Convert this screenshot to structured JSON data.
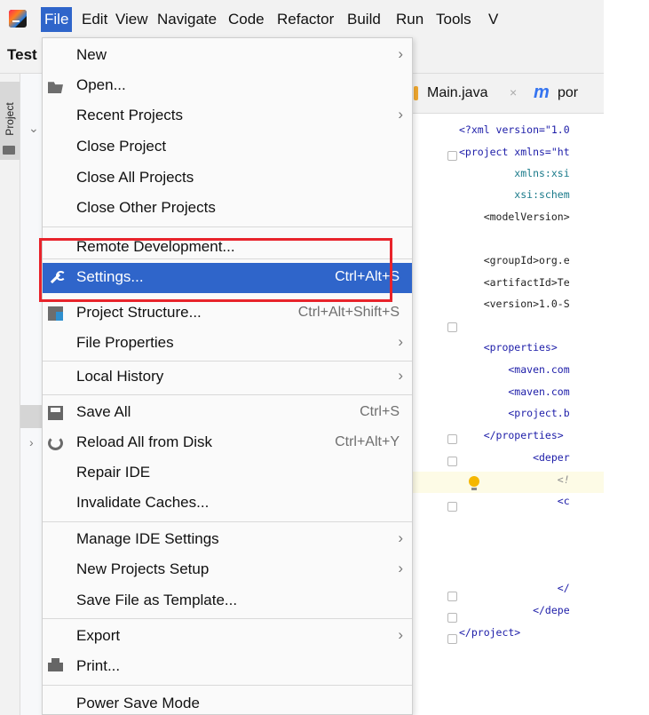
{
  "menubar": {
    "items": [
      {
        "label": "File",
        "active": true
      },
      {
        "label": "Edit"
      },
      {
        "label": "View"
      },
      {
        "label": "Navigate"
      },
      {
        "label": "Code"
      },
      {
        "label": "Refactor"
      },
      {
        "label": "Build"
      },
      {
        "label": "Run"
      },
      {
        "label": "Tools"
      },
      {
        "label": "V"
      }
    ]
  },
  "project": {
    "name": "Test",
    "tool_window_label": "Project"
  },
  "editor": {
    "tabs": [
      {
        "label": "Main.java"
      },
      {
        "label": "por"
      }
    ],
    "lines": [
      "<?xml version=\"1.0",
      "<project xmlns=\"ht",
      "         xmlns:xsi",
      "         xsi:schem",
      "    <modelVersion>",
      "",
      "    <groupId>org.e",
      "    <artifactId>Te",
      "    <version>1.0-S",
      "",
      "    <properties>",
      "        <maven.com",
      "        <maven.com",
      "        <project.b",
      "    </properties>",
      "            <deper",
      "                <!",
      "                <c",
      "",
      "",
      "",
      "                </",
      "            </depe",
      "</project>"
    ]
  },
  "file_menu": {
    "items": [
      {
        "label": "New",
        "submenu": true
      },
      {
        "label": "Open...",
        "icon": "folder-icon"
      },
      {
        "label": "Recent Projects",
        "submenu": true
      },
      {
        "label": "Close Project"
      },
      {
        "label": "Close All Projects"
      },
      {
        "label": "Close Other Projects"
      },
      {
        "label": "Remote Development..."
      },
      {
        "label": "Settings...",
        "shortcut": "Ctrl+Alt+S",
        "icon": "wrench-icon",
        "selected": true
      },
      {
        "label": "Project Structure...",
        "shortcut": "Ctrl+Alt+Shift+S",
        "icon": "project-structure-icon"
      },
      {
        "label": "File Properties",
        "submenu": true
      },
      {
        "label": "Local History",
        "submenu": true
      },
      {
        "label": "Save All",
        "shortcut": "Ctrl+S",
        "icon": "save-icon"
      },
      {
        "label": "Reload All from Disk",
        "shortcut": "Ctrl+Alt+Y",
        "icon": "reload-icon"
      },
      {
        "label": "Repair IDE"
      },
      {
        "label": "Invalidate Caches..."
      },
      {
        "label": "Manage IDE Settings",
        "submenu": true
      },
      {
        "label": "New Projects Setup",
        "submenu": true
      },
      {
        "label": "Save File as Template..."
      },
      {
        "label": "Export",
        "submenu": true
      },
      {
        "label": "Print...",
        "icon": "print-icon"
      },
      {
        "label": "Power Save Mode"
      }
    ],
    "submenu_arrow": "›"
  },
  "colors": {
    "accent": "#2f65ca",
    "highlight_box": "#e8232b"
  }
}
